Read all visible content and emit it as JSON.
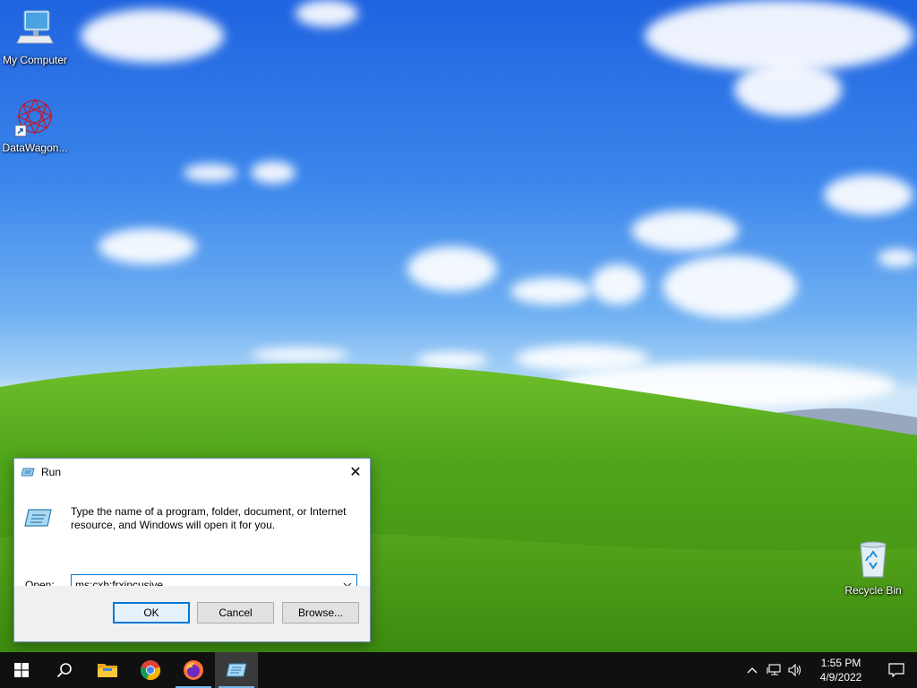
{
  "desktop": {
    "icons": [
      {
        "label": "My Computer",
        "icon": "computer-icon"
      },
      {
        "label": "DataWagon...",
        "icon": "datawagon-shortcut-icon"
      },
      {
        "label": "Recycle Bin",
        "icon": "recycle-bin-icon"
      }
    ]
  },
  "run_dialog": {
    "title": "Run",
    "description": "Type the name of a program, folder, document, or Internet resource, and Windows will open it for you.",
    "open_label": "Open:",
    "open_value": "ms:cxh:frxincusive",
    "buttons": {
      "ok": "OK",
      "cancel": "Cancel",
      "browse": "Browse..."
    },
    "accent_color": "#0078d7"
  },
  "taskbar": {
    "apps": [
      {
        "icon": "windows-start-icon"
      },
      {
        "icon": "search-icon"
      },
      {
        "icon": "file-explorer-icon"
      },
      {
        "icon": "chrome-icon"
      },
      {
        "icon": "firefox-icon"
      },
      {
        "icon": "run-app-icon",
        "active": true
      }
    ],
    "tray": {
      "icons": [
        "chevron-up-icon",
        "network-icon",
        "volume-icon"
      ]
    },
    "clock": {
      "time": "1:55 PM",
      "date": "4/9/2022"
    },
    "background_color": "#101010"
  }
}
